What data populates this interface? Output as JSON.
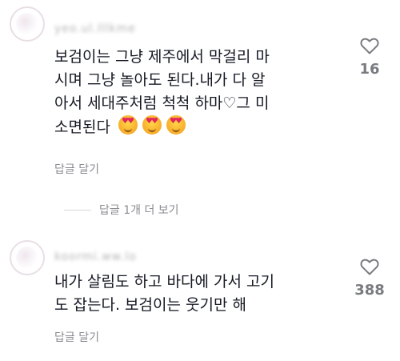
{
  "comments": [
    {
      "username": "yeo.ul.lllkme",
      "text_lines": [
        "보검이는 그냥 제주에서 막걸리 마",
        "시며 그냥 놀아도 된다.내가 다 알",
        "아서 세대주처럼 척척 하마♡그 미",
        "소면된다"
      ],
      "emojis": [
        "heart-eyes-emoji",
        "heart-eyes-emoji",
        "heart-eyes-emoji"
      ],
      "reply_label": "답글 달기",
      "like_count": "16"
    },
    {
      "username": "koormi.ww.lo",
      "text_lines": [
        "내가 살림도 하고 바다에 가서 고기",
        "도 잡는다. 보검이는 웃기만 해"
      ],
      "reply_label": "답글 달기",
      "like_count": "388"
    }
  ],
  "view_more_replies": "답글 1개 더 보기",
  "colors": {
    "text": "#161823",
    "muted": "#8a8b91",
    "heart_outline": "#7a7b80"
  }
}
